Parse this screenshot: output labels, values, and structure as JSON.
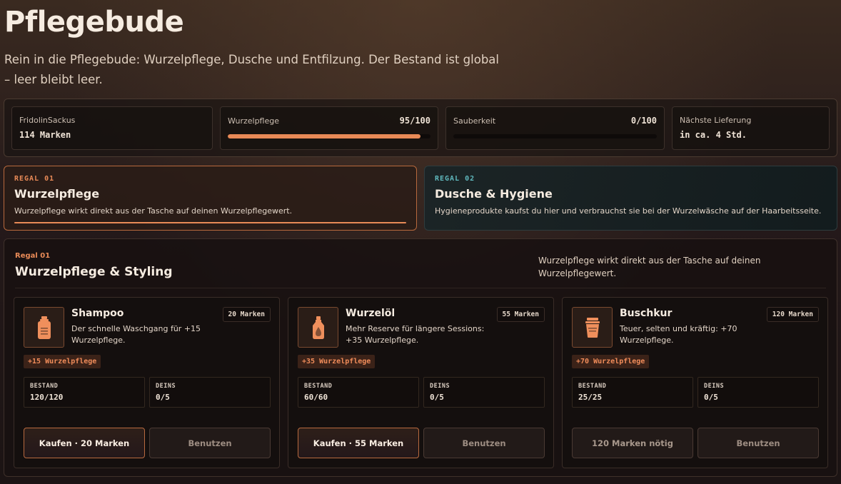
{
  "page": {
    "title": "Pflegebude",
    "subtitle": "Rein in die Pflegebude: Wurzelpflege, Dusche und Entfilzung. Der Bestand ist global – leer bleibt leer."
  },
  "stats": {
    "user_name": "FridolinSackus",
    "balance": "114 Marken",
    "wurzelpflege_label": "Wurzelpflege",
    "wurzelpflege_value": "95/100",
    "wurzelpflege_fraction": 0.95,
    "sauberkeit_label": "Sauberkeit",
    "sauberkeit_value": "0/100",
    "sauberkeit_fraction": 0,
    "delivery_label": "Nächste Lieferung",
    "delivery_value": "in ca. 4 Std."
  },
  "shelves": [
    {
      "code": "REGAL 01",
      "title": "Wurzelpflege",
      "description": "Wurzelpflege wirkt direkt aus der Tasche auf deinen Wurzelpflegewert."
    },
    {
      "code": "REGAL 02",
      "title": "Dusche & Hygiene",
      "description": "Hygieneprodukte kaufst du hier und verbrauchst sie bei der Wurzelwäsche auf der Haarbeitsseite."
    }
  ],
  "section": {
    "code": "Regal 01",
    "title": "Wurzelpflege & Styling",
    "description": "Wurzelpflege wirkt direkt aus der Tasche auf deinen Wurzelpflegewert."
  },
  "products": [
    {
      "name": "Shampoo",
      "price": "20 Marken",
      "description": "Der schnelle Waschgang für +15 Wurzelpflege.",
      "effect": "+15 Wurzelpflege",
      "stock_label": "BESTAND",
      "stock_value": "120/120",
      "owned_label": "DEINS",
      "owned_value": "0/5",
      "buy_label": "Kaufen · 20 Marken",
      "use_label": "Benutzen",
      "icon": "shampoo-bottle-icon"
    },
    {
      "name": "Wurzelöl",
      "price": "55 Marken",
      "description": "Mehr Reserve für längere Sessions: +35 Wurzelpflege.",
      "effect": "+35 Wurzelpflege",
      "stock_label": "BESTAND",
      "stock_value": "60/60",
      "owned_label": "DEINS",
      "owned_value": "0/5",
      "buy_label": "Kaufen · 55 Marken",
      "use_label": "Benutzen",
      "icon": "oil-bottle-icon"
    },
    {
      "name": "Buschkur",
      "price": "120 Marken",
      "description": "Teuer, selten und kräftig: +70 Wurzelpflege.",
      "effect": "+70 Wurzelpflege",
      "stock_label": "BESTAND",
      "stock_value": "25/25",
      "owned_label": "DEINS",
      "owned_value": "0/5",
      "buy_label": "120 Marken nötig",
      "use_label": "Benutzen",
      "icon": "jar-icon"
    }
  ],
  "colors": {
    "accent": "#e88a57",
    "teal": "#5fb8bd",
    "icon": "#ef8f5c"
  }
}
